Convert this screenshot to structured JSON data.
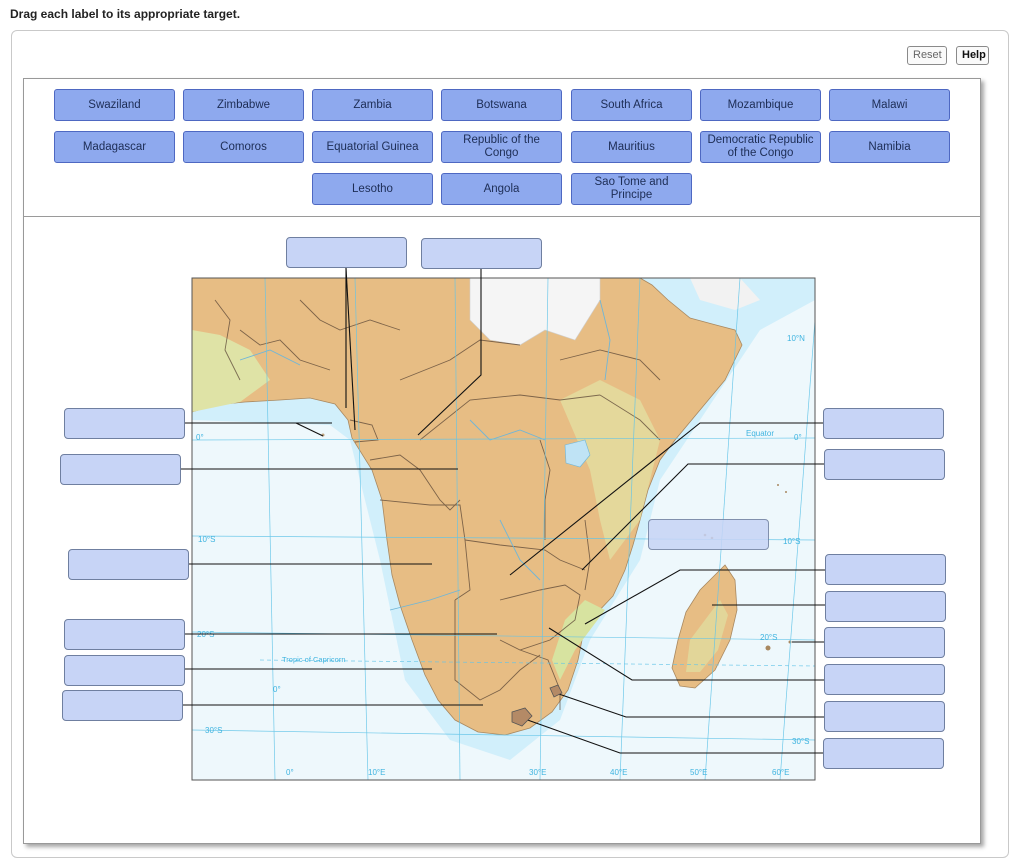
{
  "instruction": "Drag each label to its appropriate target.",
  "toolbar": {
    "reset_label": "Reset",
    "help_label": "Help"
  },
  "labels": [
    "Swaziland",
    "Zimbabwe",
    "Zambia",
    "Botswana",
    "South Africa",
    "Mozambique",
    "Malawi",
    "Madagascar",
    "Comoros",
    "Equatorial Guinea",
    "Republic of the Congo",
    "Mauritius",
    "Democratic Republic of the Congo",
    "Namibia",
    "Lesotho",
    "Angola",
    "Sao Tome and Principe"
  ],
  "map": {
    "graticule_labels": {
      "lat_10n": "10°N",
      "equator": "Equator",
      "equator_deg_right": "0°",
      "equator_deg_left": "0°",
      "lat_10s_left": "10°S",
      "lat_10s_right": "10°S",
      "lat_20s_left": "20°S",
      "lat_20s_right": "20°S",
      "tropic": "Tropic of Capricorn",
      "lat_30s_left": "30°S",
      "lat_30s_right": "30°S",
      "lon_0_mid": "0°",
      "lon_0": "0°",
      "lon_10e": "10°E",
      "lon_30e": "30°E",
      "lon_40e": "40°E",
      "lon_50e": "50°E",
      "lon_60e": "60°E"
    },
    "colors": {
      "ocean": "#e6f5fb",
      "land_low": "#e9e6a9",
      "land_high": "#e3b277",
      "border": "#5a4535",
      "river": "#6fb6d8",
      "graticule": "#62c4e8"
    }
  }
}
